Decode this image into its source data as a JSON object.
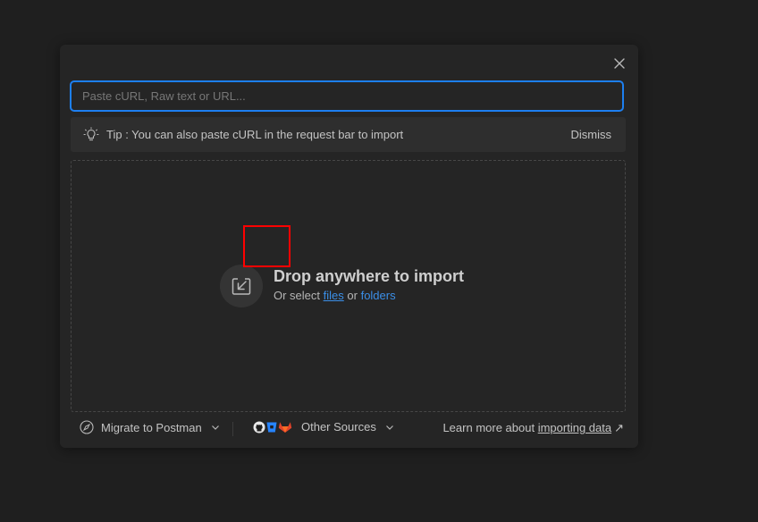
{
  "dialog": {
    "search": {
      "placeholder": "Paste cURL, Raw text or URL...",
      "value": ""
    },
    "tip": {
      "text": "Tip : You can also paste cURL in the request bar to import",
      "dismiss_label": "Dismiss"
    },
    "dropzone": {
      "title": "Drop anywhere to import",
      "subtitle_prefix": "Or select",
      "files_link": "files",
      "or_text": "or",
      "folders_link": "folders"
    },
    "footer": {
      "migrate_label": "Migrate to Postman",
      "other_sources_label": "Other Sources",
      "learn_prefix": "Learn more about",
      "learn_link": "importing data",
      "learn_arrow": "↗"
    }
  },
  "icons": {
    "close": "close-icon",
    "tip": "lightbulb-icon",
    "drop": "import-arrow-icon",
    "migrate": "compass-icon",
    "sources": [
      "github-icon",
      "bitbucket-icon",
      "gitlab-icon"
    ],
    "chevron": "chevron-down-icon"
  },
  "colors": {
    "background": "#1f1f1f",
    "panel": "#252525",
    "accent": "#1d7ff0",
    "link": "#3b8fe8",
    "highlight": "#ff0000",
    "gitlab": "#e2432a",
    "bitbucket": "#2684ff"
  }
}
